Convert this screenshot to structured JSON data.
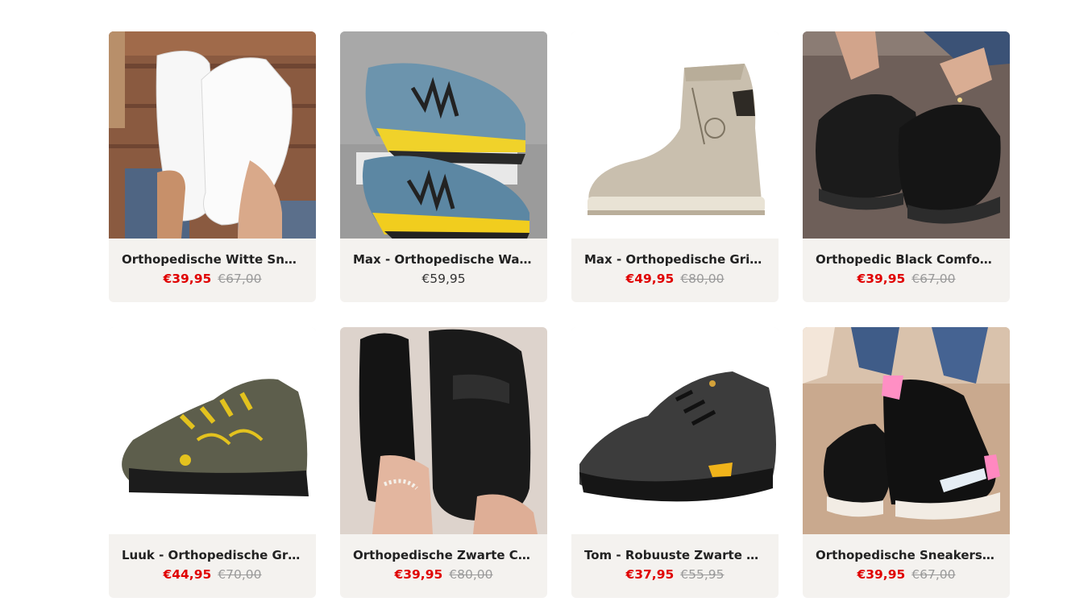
{
  "products": [
    {
      "title": "Orthopedische Witte Sneakers",
      "price": "€39,95",
      "compare_price": "€67,00",
      "image": "white-sneaker-photo"
    },
    {
      "title": "Max - Orthopedische Wandelschoenen",
      "price": "€59,95",
      "compare_price": "",
      "image": "blue-trail-shoe-photo"
    },
    {
      "title": "Max - Orthopedische Grijze Laarzen",
      "price": "€49,95",
      "compare_price": "€80,00",
      "image": "grey-boot-photo"
    },
    {
      "title": "Orthopedic Black Comfort Sneakers",
      "price": "€39,95",
      "compare_price": "€67,00",
      "image": "black-knit-sneaker-photo"
    },
    {
      "title": "Luuk - Orthopedische Groene Wandelschoenen",
      "price": "€44,95",
      "compare_price": "€70,00",
      "image": "green-hiking-shoe-photo"
    },
    {
      "title": "Orthopedische Zwarte Chelsea Loafers",
      "price": "€39,95",
      "compare_price": "€80,00",
      "image": "black-loafer-photo"
    },
    {
      "title": "Tom - Robuuste Zwarte Wandelschoenen",
      "price": "€37,95",
      "compare_price": "€55,95",
      "image": "black-hiking-shoe-photo"
    },
    {
      "title": "Orthopedische Sneakers Zwart Roze",
      "price": "€39,95",
      "compare_price": "€67,00",
      "image": "black-pink-sneaker-photo"
    }
  ],
  "colors": {
    "card_bg": "#f4f2ef",
    "sale_price": "#e00000",
    "compare_price": "#9a9a9a",
    "title": "#222222"
  }
}
